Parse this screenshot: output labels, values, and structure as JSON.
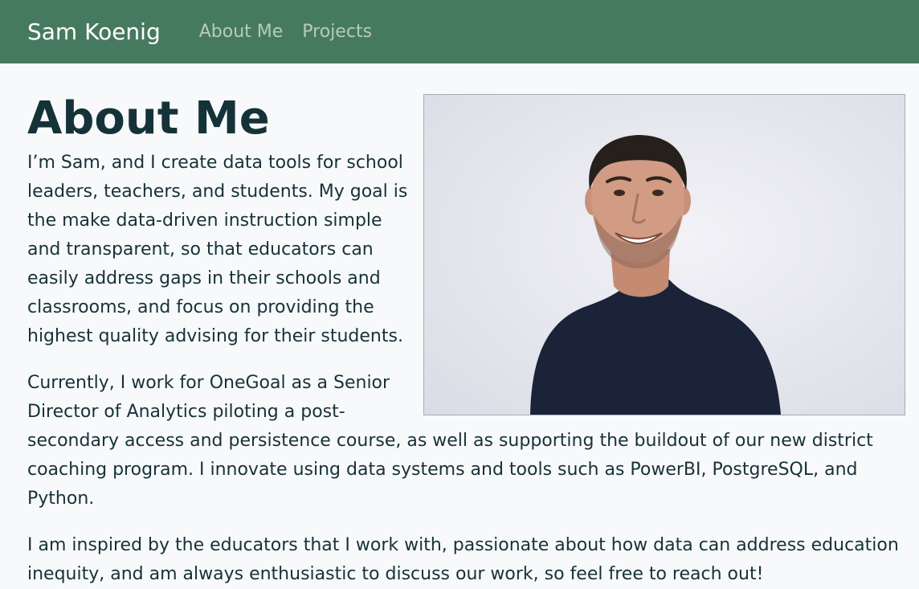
{
  "navbar": {
    "brand": "Sam Koenig",
    "links": [
      {
        "label": "About Me"
      },
      {
        "label": "Projects"
      }
    ]
  },
  "main": {
    "title": "About Me",
    "photo_alt": "Photo of Sam Koenig",
    "paragraphs": [
      "I’m Sam, and I create data tools for school leaders, teachers, and students. My goal is the make data-driven instruction simple and transparent, so that educators can easily address gaps in their schools and classrooms, and focus on providing the highest quality advising for their students.",
      "Currently, I work for OneGoal as a Senior Director of Analytics piloting a post-secondary access and persistence course, as well as supporting the buildout of our new district coaching program. I innovate using data systems and tools such as PowerBI, PostgreSQL, and Python.",
      "I am inspired by the educators that I work with, passionate about how data can address education inequity, and am always enthusiastic to discuss our work, so feel free to reach out!"
    ]
  },
  "colors": {
    "navbar_bg": "#467a5f",
    "page_bg": "#f8f9fa",
    "text": "#163239",
    "nav_link": "#b8cabe"
  }
}
